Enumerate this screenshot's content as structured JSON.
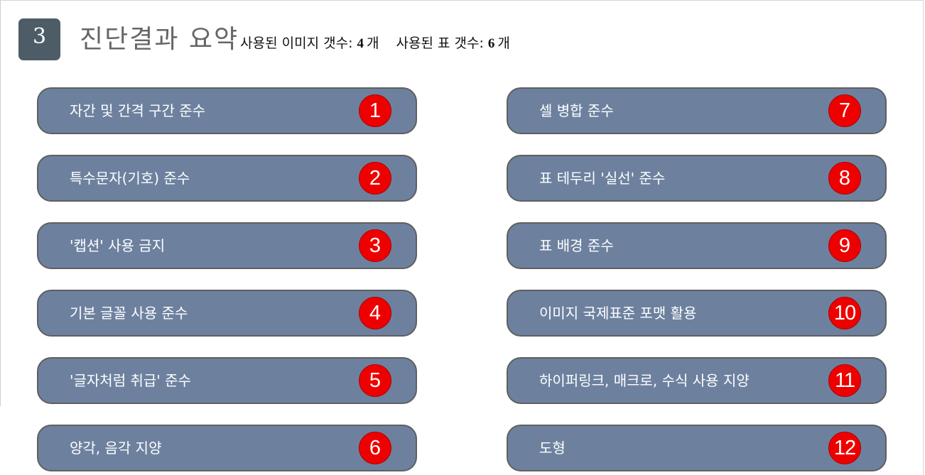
{
  "header": {
    "section_number": "3",
    "title": "진단결과 요약",
    "images_label": "사용된 이미지 갯수:",
    "images_count": "4",
    "images_unit": "개",
    "tables_label": "사용된 표 갯수:",
    "tables_count": "6",
    "tables_unit": "개"
  },
  "items": [
    {
      "number": "1",
      "label": "자간 및 간격 구간 준수"
    },
    {
      "number": "2",
      "label": "특수문자(기호) 준수"
    },
    {
      "number": "3",
      "label": "'캡션' 사용 금지"
    },
    {
      "number": "4",
      "label": "기본 글꼴 사용 준수"
    },
    {
      "number": "5",
      "label": "'글자처럼 취급' 준수"
    },
    {
      "number": "6",
      "label": "양각, 음각 지양"
    },
    {
      "number": "7",
      "label": "셀 병합 준수"
    },
    {
      "number": "8",
      "label": "표 테두리 '실선' 준수"
    },
    {
      "number": "9",
      "label": "표 배경 준수"
    },
    {
      "number": "10",
      "label": "이미지 국제표준 포맷 활용"
    },
    {
      "number": "11",
      "label": "하이퍼링크, 매크로, 수식 사용 지양"
    },
    {
      "number": "12",
      "label": "도형"
    }
  ],
  "colors": {
    "pill_fill": "#6d819f",
    "pill_border": "#5f5f5f",
    "badge_red": "#ee0000",
    "section_badge": "#4d5c66",
    "title_gray": "#666666"
  }
}
